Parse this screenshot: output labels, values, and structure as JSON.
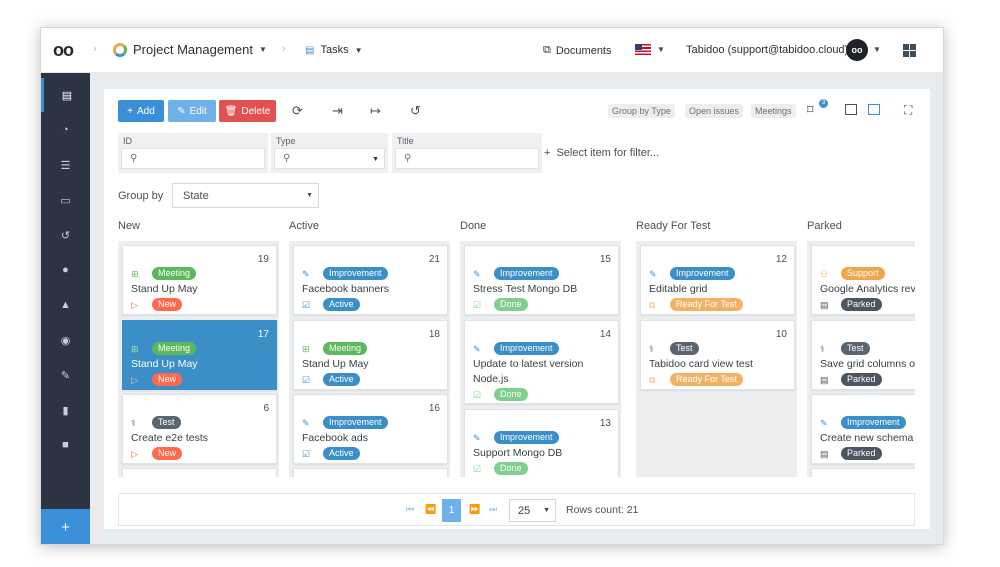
{
  "header": {
    "logo": "oo",
    "app": "Project Management",
    "page": "Tasks",
    "documents": "Documents",
    "user": "Tabidoo (support@tabidoo.cloud)",
    "avatar": "oo"
  },
  "toolbar": {
    "add": "Add",
    "edit": "Edit",
    "delete": "Delete",
    "pills": [
      "Group by Type",
      "Open issues",
      "Meetings"
    ],
    "tag_count": "3"
  },
  "filters": {
    "id_label": "ID",
    "type_label": "Type",
    "title_label": "Title",
    "select_item": "Select item for filter..."
  },
  "group_by": {
    "label": "Group by",
    "value": "State"
  },
  "columns": [
    {
      "name": "New",
      "cards": [
        {
          "num": "19",
          "type": "Meeting",
          "title": "Stand Up May",
          "state": "New"
        },
        {
          "num": "17",
          "type": "Meeting",
          "title": "Stand Up May",
          "state": "New"
        },
        {
          "num": "6",
          "type": "Test",
          "title": "Create e2e tests",
          "state": "New"
        }
      ]
    },
    {
      "name": "Active",
      "cards": [
        {
          "num": "21",
          "type": "Improvement",
          "title": "Facebook banners",
          "state": "Active"
        },
        {
          "num": "18",
          "type": "Meeting",
          "title": "Stand Up May",
          "state": "Active"
        },
        {
          "num": "16",
          "type": "Improvement",
          "title": "Facebook ads",
          "state": "Active"
        }
      ]
    },
    {
      "name": "Done",
      "cards": [
        {
          "num": "15",
          "type": "Improvement",
          "title": "Stress Test Mongo DB",
          "state": "Done"
        },
        {
          "num": "14",
          "type": "Improvement",
          "title": "Update to latest version",
          "title2": "Node.js",
          "state": "Done"
        },
        {
          "num": "13",
          "type": "Improvement",
          "title": "Support Mongo DB",
          "state": "Done"
        }
      ]
    },
    {
      "name": "Ready For Test",
      "cards": [
        {
          "num": "12",
          "type": "Improvement",
          "title": "Editable grid",
          "state": "Ready For Test"
        },
        {
          "num": "10",
          "type": "Test",
          "title": "Tabidoo card view test",
          "state": "Ready For Test"
        }
      ]
    },
    {
      "name": "Parked",
      "cards": [
        {
          "num": "",
          "type": "Support",
          "title": "Google Analytics revie",
          "state": "Parked"
        },
        {
          "num": "",
          "type": "Test",
          "title": "Save grid columns ord",
          "state": "Parked"
        },
        {
          "num": "",
          "type": "Improvement",
          "title": "Create new schema",
          "state": "Parked"
        }
      ]
    }
  ],
  "pager": {
    "page": "1",
    "size": "25",
    "rows": "Rows count: 21"
  },
  "colors": {
    "accent": "#3b8fd9",
    "meeting": "#5cb85c",
    "improvement": "#3a8fc8",
    "test": "#5a6570",
    "support": "#f0a64a",
    "new": "#ff6a4d",
    "active": "#3a8fc8",
    "done": "#7fcf8f",
    "ready": "#f2b266",
    "parked": "#4d5660"
  }
}
